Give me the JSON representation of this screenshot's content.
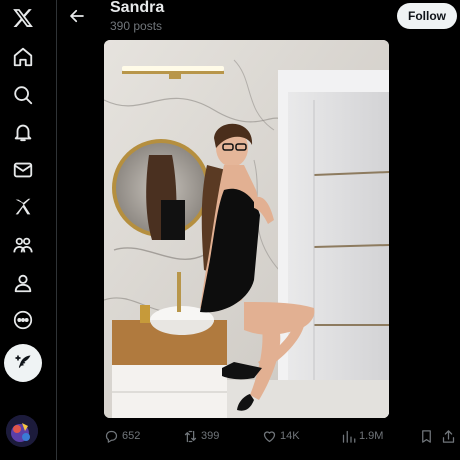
{
  "profile": {
    "name": "Sandra",
    "post_count": "390 posts",
    "follow_label": "Follow"
  },
  "nav": {
    "items": [
      {
        "icon": "x-logo-icon"
      },
      {
        "icon": "home-icon"
      },
      {
        "icon": "search-icon"
      },
      {
        "icon": "notifications-icon"
      },
      {
        "icon": "messages-icon"
      },
      {
        "icon": "grok-icon"
      },
      {
        "icon": "communities-icon"
      },
      {
        "icon": "profile-icon"
      },
      {
        "icon": "more-icon"
      }
    ],
    "compose_icon": "compose-post-icon"
  },
  "post": {
    "replies": "652",
    "reposts": "399",
    "likes": "14K",
    "views": "1.9M"
  },
  "colors": {
    "background": "#000000",
    "text": "#e7e9ea",
    "muted": "#71767b",
    "button_bg": "#eff3f4"
  }
}
